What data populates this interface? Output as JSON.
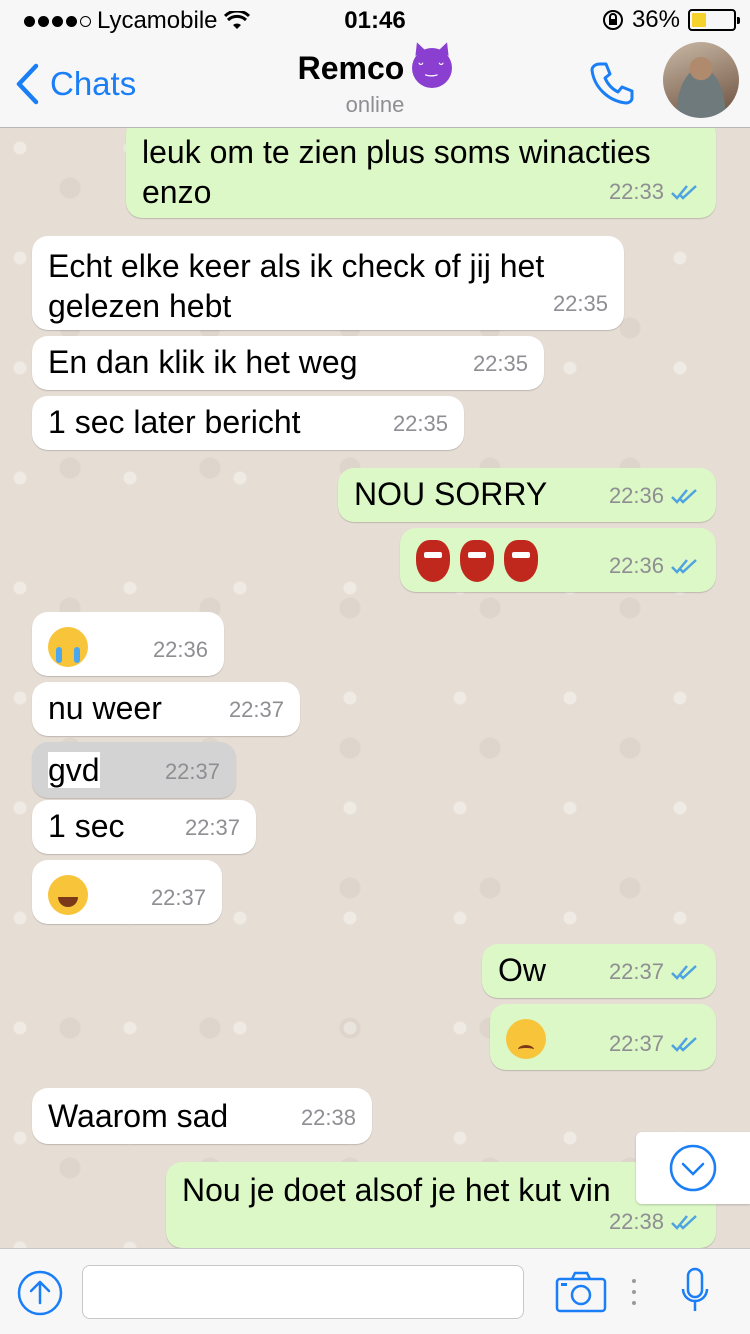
{
  "status_bar": {
    "carrier": "Lycamobile",
    "time": "01:46",
    "battery_percent": "36%",
    "battery_level": 0.36,
    "signal_bars_filled": 4,
    "signal_bars_total": 5
  },
  "nav": {
    "back_label": "Chats",
    "contact_name": "Remco",
    "contact_emoji": "smiling-devil-icon",
    "status": "online"
  },
  "messages": [
    {
      "direction": "out",
      "text": "leuk om te zien plus soms winacties enzo",
      "line1": "leuk om te zien plus soms winacties",
      "line2": "enzo",
      "time": "22:33",
      "read": true
    },
    {
      "direction": "in",
      "line1": "Echt elke keer als ik check of jij het",
      "line2": "gelezen hebt",
      "time": "22:35"
    },
    {
      "direction": "in",
      "text": "En dan klik ik het weg",
      "time": "22:35"
    },
    {
      "direction": "in",
      "text": "1 sec later bericht",
      "time": "22:35"
    },
    {
      "direction": "out",
      "text": "NOU SORRY",
      "time": "22:36",
      "read": true
    },
    {
      "direction": "out",
      "emoji": "goblin-icon x3",
      "time": "22:36",
      "read": true
    },
    {
      "direction": "in",
      "emoji": "crying-face-icon",
      "time": "22:36"
    },
    {
      "direction": "in",
      "text": "nu weer",
      "time": "22:37"
    },
    {
      "direction": "in",
      "text": "gvd",
      "time": "22:37",
      "selected": true
    },
    {
      "direction": "in",
      "text": "1 sec",
      "time": "22:37"
    },
    {
      "direction": "in",
      "emoji": "tears-of-joy-icon",
      "time": "22:37"
    },
    {
      "direction": "out",
      "text": "Ow",
      "time": "22:37",
      "read": true
    },
    {
      "direction": "out",
      "emoji": "disappointed-face-icon",
      "time": "22:37",
      "read": true
    },
    {
      "direction": "in",
      "text": "Waarom sad",
      "time": "22:38"
    },
    {
      "direction": "out",
      "text": "Nou je doet alsof je het kut vin",
      "time": "22:38",
      "read": true
    }
  ],
  "colors": {
    "accent": "#1a7ef7",
    "outgoing_bubble": "#dcf8c6",
    "incoming_bubble": "#ffffff",
    "read_ticks": "#4fa3e0",
    "chat_background": "#e6ded5"
  }
}
